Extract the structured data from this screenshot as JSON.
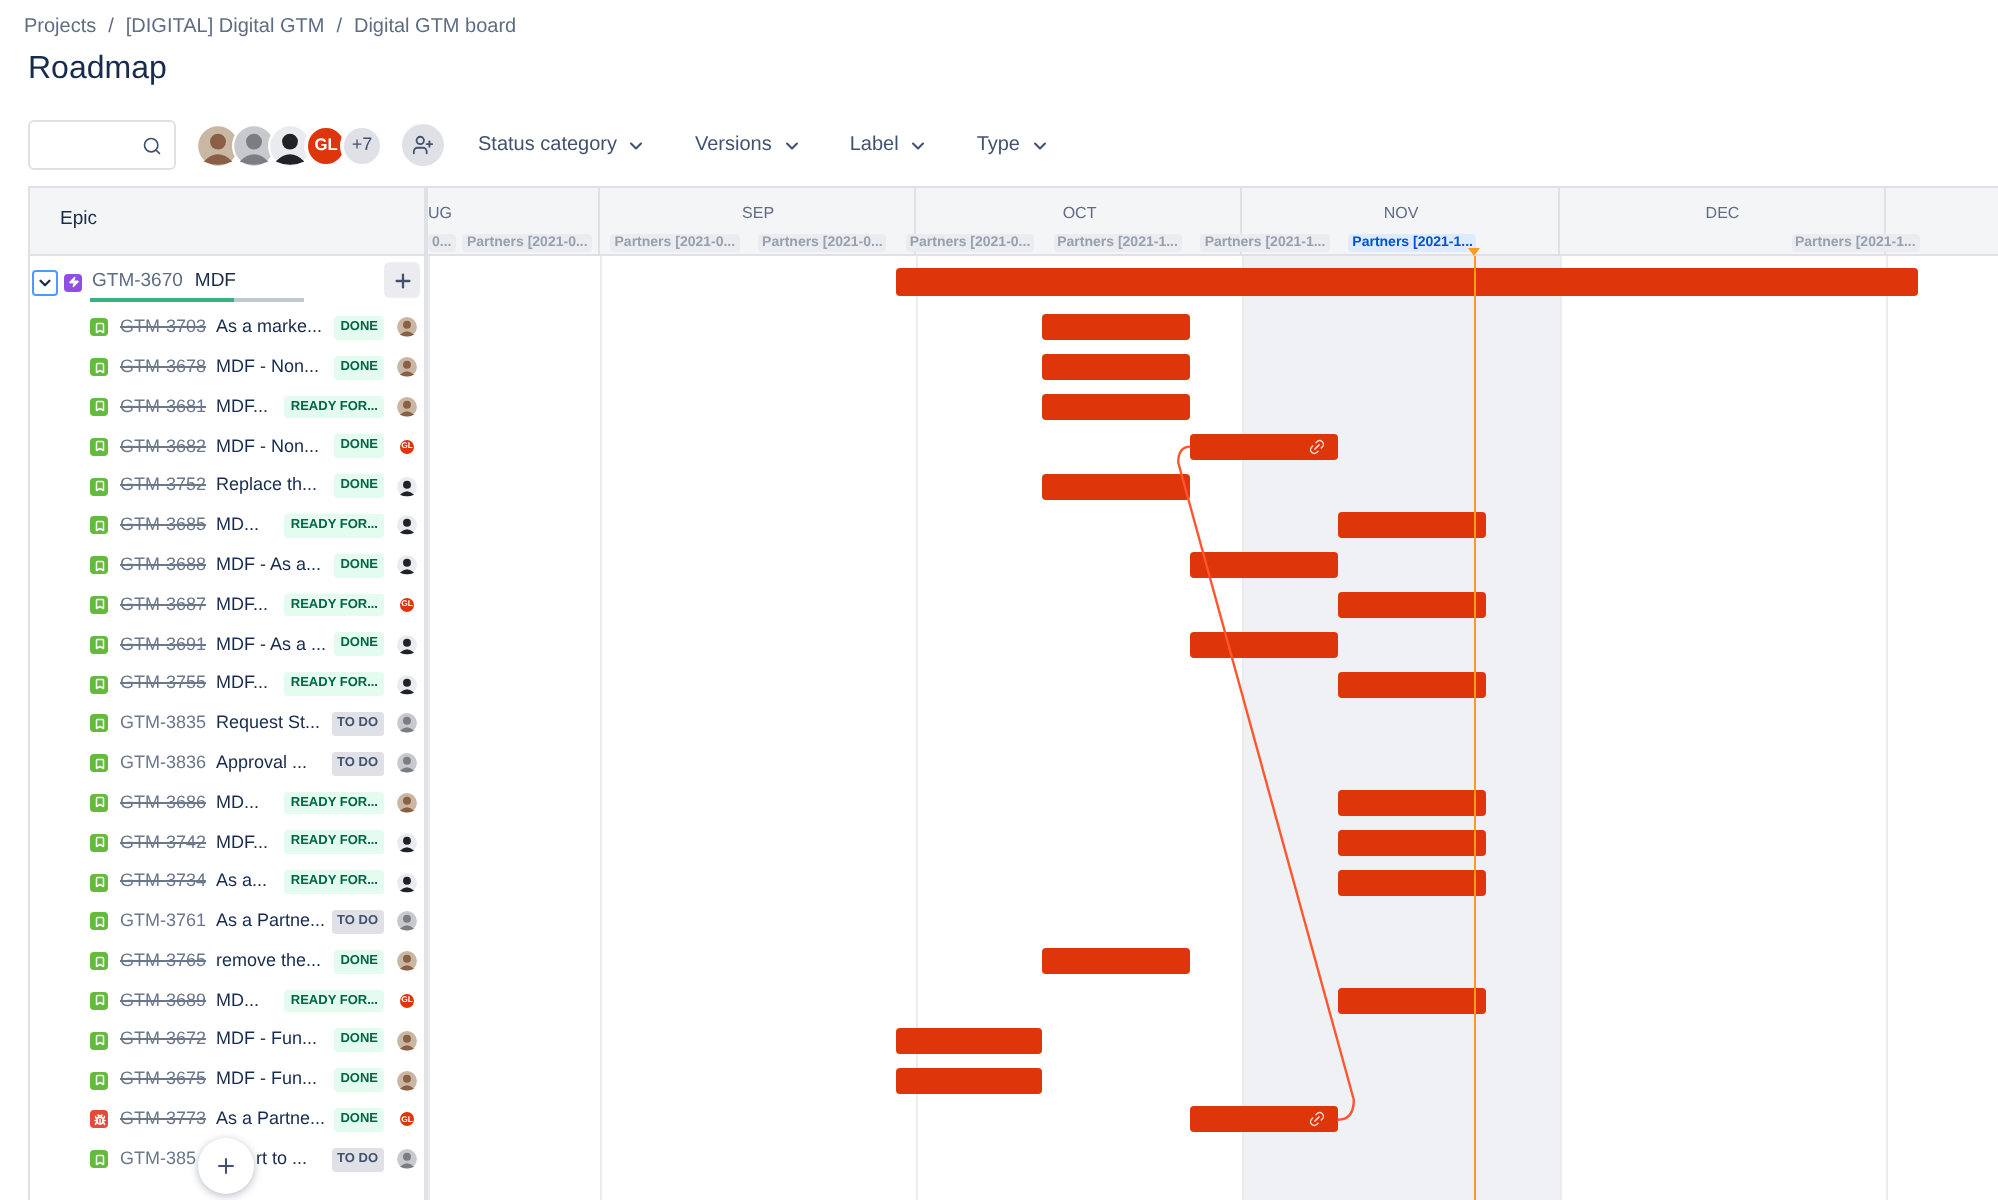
{
  "breadcrumbs": [
    "Projects",
    "/",
    "[DIGITAL] Digital GTM",
    "/",
    "Digital GTM board"
  ],
  "title": "Roadmap",
  "toolbar": {
    "avatars": [
      {
        "kind": "photo"
      },
      {
        "kind": "grey"
      },
      {
        "kind": "person"
      },
      {
        "kind": "initials",
        "initials": "GL"
      }
    ],
    "more_count": "+7",
    "filters": [
      "Status category",
      "Versions",
      "Label",
      "Type"
    ]
  },
  "roadmap": {
    "column_header": "Epic",
    "months": [
      {
        "label": "UG",
        "current": false
      },
      {
        "label": "SEP",
        "current": false
      },
      {
        "label": "OCT",
        "current": false
      },
      {
        "label": "NOV",
        "current": true
      },
      {
        "label": "DEC",
        "current": false
      },
      {
        "current": false
      }
    ],
    "releases": [
      {
        "label": "0...",
        "selected": false
      },
      {
        "label": "Partners [2021-0...",
        "selected": false
      },
      {
        "label": "Partners [2021-0...",
        "selected": false
      },
      {
        "label": "Partners [2021-0...",
        "selected": false
      },
      {
        "label": "Partners [2021-0...",
        "selected": false
      },
      {
        "label": "Partners [2021-1...",
        "selected": false
      },
      {
        "label": "Partners [2021-1...",
        "selected": false
      },
      {
        "label": "Partners [2021-1...",
        "selected": true
      },
      {
        "label": "Partners [2021-1...",
        "selected": false
      }
    ],
    "epic": {
      "key": "GTM-3670",
      "summary": "MDF",
      "expanded": true,
      "level": 0.67,
      "children": [
        {
          "kind": "story",
          "key": "GTM-3703",
          "resolved": true,
          "summary": "As a marke...",
          "status": {
            "text": "DONE",
            "kind": "done"
          },
          "assignee": {
            "kind": "photo"
          },
          "linked": false
        },
        {
          "kind": "story",
          "key": "GTM-3678",
          "resolved": true,
          "summary": "MDF - Non...",
          "status": {
            "text": "DONE",
            "kind": "done"
          },
          "assignee": {
            "kind": "photo"
          },
          "linked": false
        },
        {
          "kind": "story",
          "key": "GTM-3681",
          "resolved": true,
          "summary": "MDF...",
          "status": {
            "text": "READY FOR...",
            "kind": "done"
          },
          "assignee": {
            "kind": "photo"
          },
          "linked": false
        },
        {
          "kind": "story",
          "key": "GTM-3682",
          "resolved": true,
          "summary": "MDF - Non...",
          "status": {
            "text": "DONE",
            "kind": "done"
          },
          "assignee": {
            "kind": "initials",
            "initials": "GL"
          },
          "linked": true
        },
        {
          "kind": "story",
          "key": "GTM-3752",
          "resolved": true,
          "summary": "Replace th...",
          "status": {
            "text": "DONE",
            "kind": "done"
          },
          "assignee": {
            "kind": "person"
          },
          "linked": false
        },
        {
          "kind": "story",
          "key": "GTM-3685",
          "resolved": true,
          "summary": "MD...",
          "status": {
            "text": "READY FOR...",
            "kind": "done"
          },
          "assignee": {
            "kind": "person"
          },
          "linked": false
        },
        {
          "kind": "story",
          "key": "GTM-3688",
          "resolved": true,
          "summary": "MDF - As a...",
          "status": {
            "text": "DONE",
            "kind": "done"
          },
          "assignee": {
            "kind": "person"
          },
          "linked": false
        },
        {
          "kind": "story",
          "key": "GTM-3687",
          "resolved": true,
          "summary": "MDF...",
          "status": {
            "text": "READY FOR...",
            "kind": "done"
          },
          "assignee": {
            "kind": "initials",
            "initials": "GL"
          },
          "linked": false
        },
        {
          "kind": "story",
          "key": "GTM-3691",
          "resolved": true,
          "summary": "MDF - As a ...",
          "status": {
            "text": "DONE",
            "kind": "done"
          },
          "assignee": {
            "kind": "person"
          },
          "linked": false
        },
        {
          "kind": "story",
          "key": "GTM-3755",
          "resolved": true,
          "summary": "MDF...",
          "status": {
            "text": "READY FOR...",
            "kind": "done"
          },
          "assignee": {
            "kind": "person"
          },
          "linked": false
        },
        {
          "kind": "story",
          "key": "GTM-3835",
          "resolved": false,
          "summary": "Request St...",
          "status": {
            "text": "TO DO",
            "kind": "todo"
          },
          "assignee": {
            "kind": "grey"
          }
        },
        {
          "kind": "story",
          "key": "GTM-3836",
          "resolved": false,
          "summary": "Approval ...",
          "status": {
            "text": "TO DO",
            "kind": "todo"
          },
          "assignee": {
            "kind": "grey"
          }
        },
        {
          "kind": "story",
          "key": "GTM-3686",
          "resolved": true,
          "summary": "MD...",
          "status": {
            "text": "READY FOR...",
            "kind": "done"
          },
          "assignee": {
            "kind": "photo"
          },
          "linked": false
        },
        {
          "kind": "story",
          "key": "GTM-3742",
          "resolved": true,
          "summary": "MDF...",
          "status": {
            "text": "READY FOR...",
            "kind": "done"
          },
          "assignee": {
            "kind": "person"
          },
          "linked": false
        },
        {
          "kind": "story",
          "key": "GTM-3734",
          "resolved": true,
          "summary": "As a...",
          "status": {
            "text": "READY FOR...",
            "kind": "done"
          },
          "assignee": {
            "kind": "person"
          },
          "linked": false
        },
        {
          "kind": "story",
          "key": "GTM-3761",
          "resolved": false,
          "summary": "As a Partne...",
          "status": {
            "text": "TO DO",
            "kind": "todo"
          },
          "assignee": {
            "kind": "grey"
          }
        },
        {
          "kind": "story",
          "key": "GTM-3765",
          "resolved": true,
          "summary": "remove the...",
          "status": {
            "text": "DONE",
            "kind": "done"
          },
          "assignee": {
            "kind": "photo"
          },
          "linked": false
        },
        {
          "kind": "story",
          "key": "GTM-3689",
          "resolved": true,
          "summary": "MD...",
          "status": {
            "text": "READY FOR...",
            "kind": "done"
          },
          "assignee": {
            "kind": "initials",
            "initials": "GL"
          },
          "linked": false
        },
        {
          "kind": "story",
          "key": "GTM-3672",
          "resolved": true,
          "summary": "MDF - Fun...",
          "status": {
            "text": "DONE",
            "kind": "done"
          },
          "assignee": {
            "kind": "photo"
          },
          "linked": false
        },
        {
          "kind": "story",
          "key": "GTM-3675",
          "resolved": true,
          "summary": "MDF - Fun...",
          "status": {
            "text": "DONE",
            "kind": "done"
          },
          "assignee": {
            "kind": "photo"
          },
          "linked": false
        },
        {
          "kind": "bug",
          "key": "GTM-3773",
          "resolved": true,
          "summary": "As a Partne...",
          "status": {
            "text": "DONE",
            "kind": "done"
          },
          "assignee": {
            "kind": "initials",
            "initials": "GL"
          },
          "linked": true
        },
        {
          "kind": "story",
          "key": "GTM-385",
          "resolved": false,
          "summary": "rt to ...",
          "status": {
            "text": "TO DO",
            "kind": "todo"
          },
          "assignee": {
            "kind": "grey"
          }
        }
      ]
    }
  }
}
